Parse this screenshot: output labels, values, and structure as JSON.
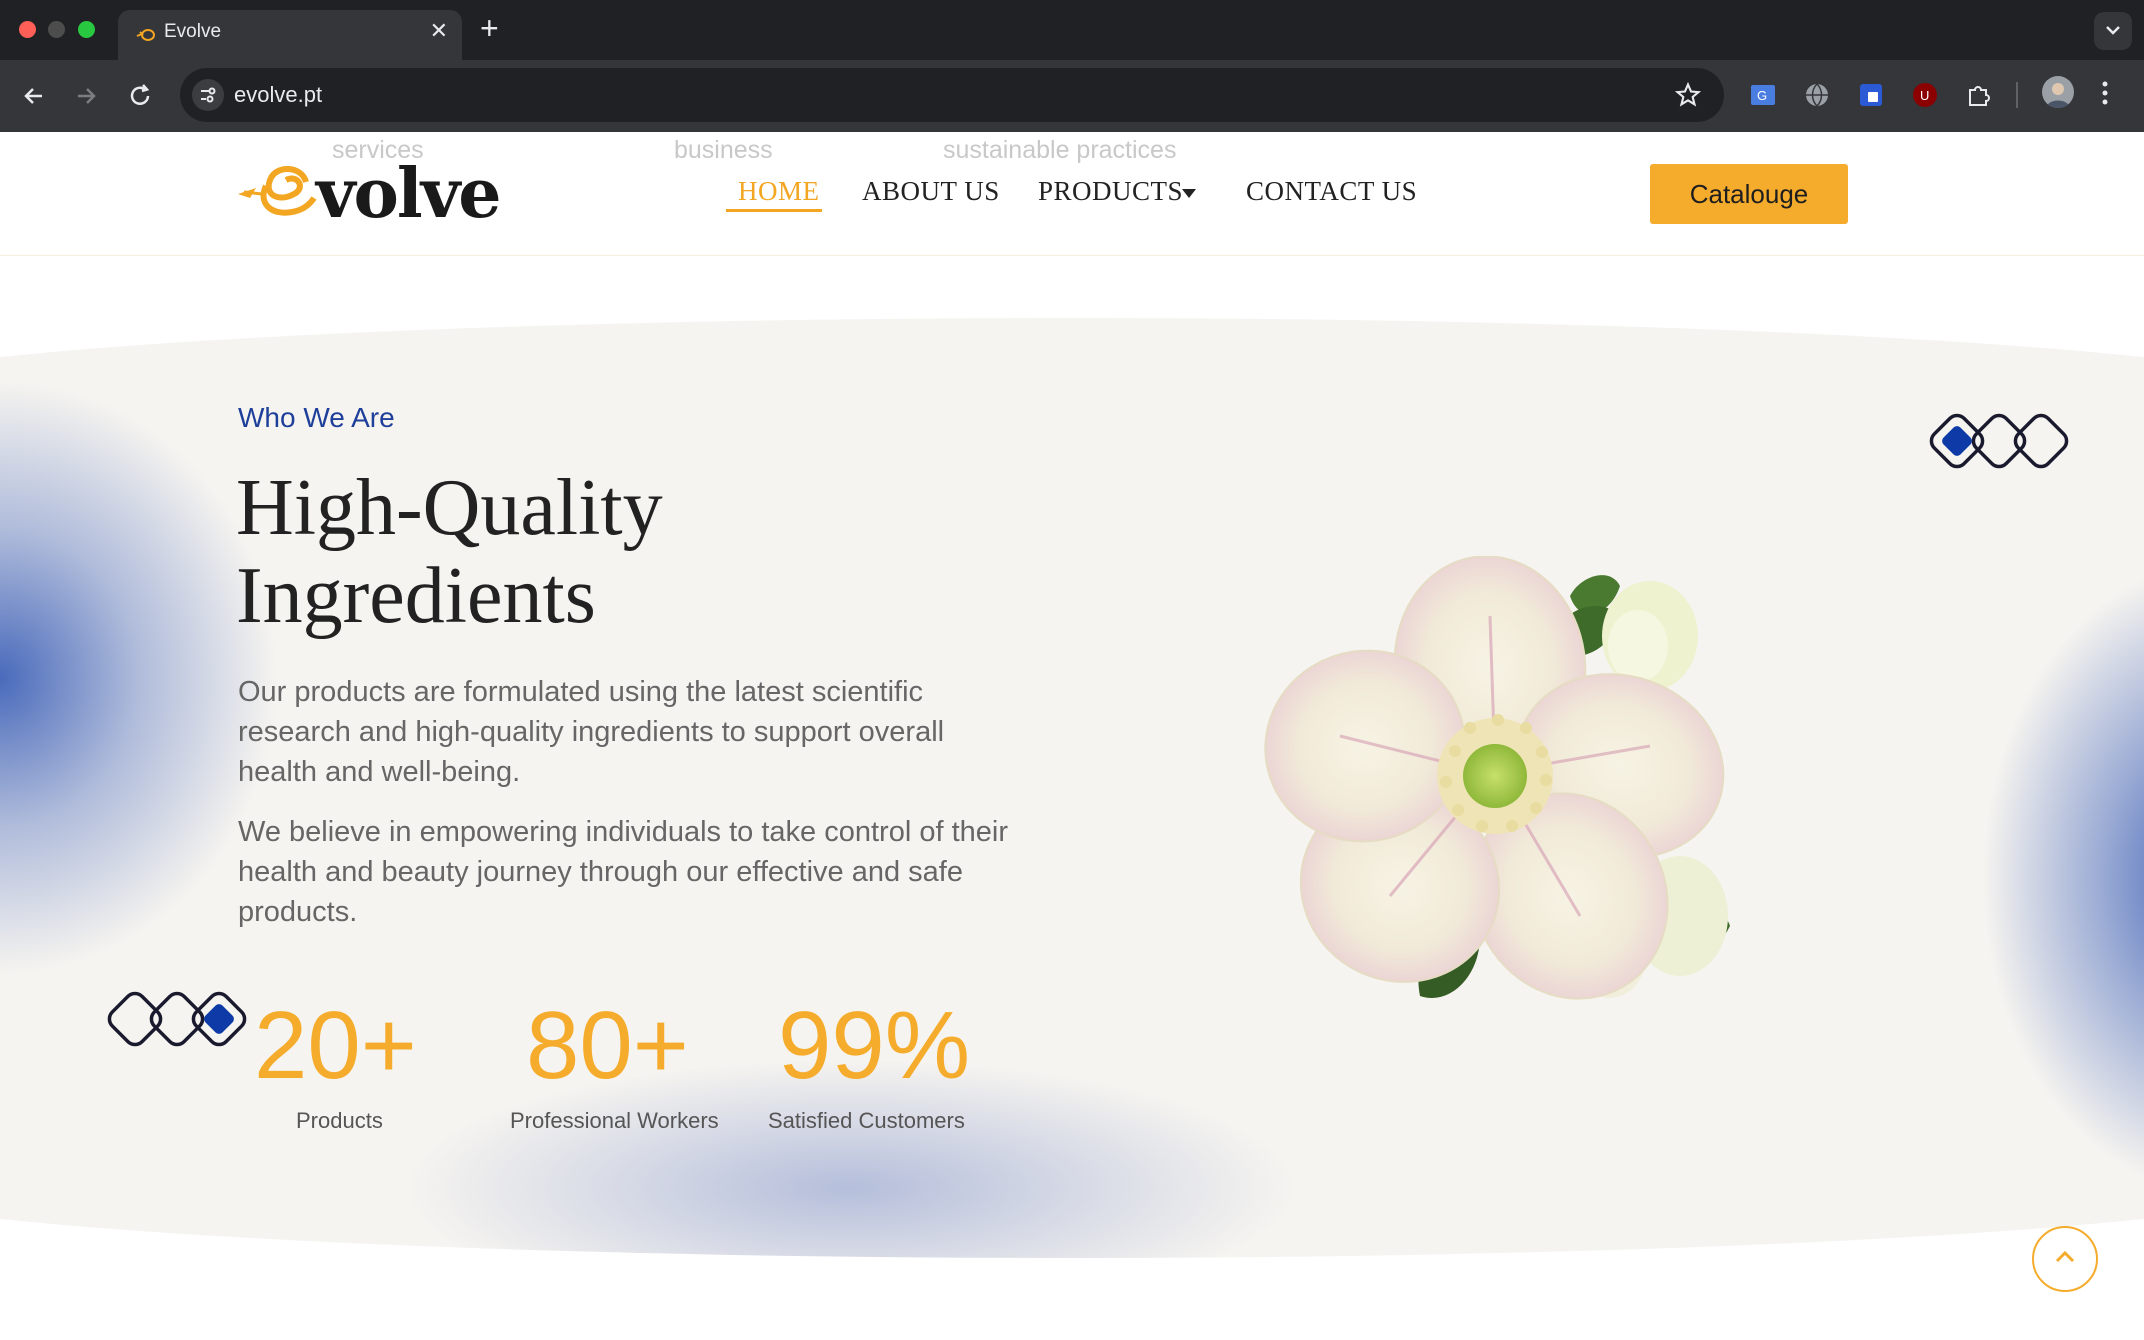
{
  "browser": {
    "tab_title": "Evolve",
    "url": "evolve.pt",
    "icons": [
      "close-icon",
      "plus-icon",
      "back-icon",
      "forward-icon",
      "reload-icon",
      "site-info-icon",
      "star-icon",
      "translate-icon",
      "globe-icon",
      "shield-icon",
      "ublock-icon",
      "puzzle-icon",
      "avatar",
      "more-vert-icon"
    ]
  },
  "header": {
    "ghost_words": [
      "services",
      "business",
      "sustainable practices"
    ],
    "logo_text": "volve",
    "nav": {
      "home": "HOME",
      "about": "ABOUT US",
      "products": "PRODUCTS",
      "contact": "CONTACT US"
    },
    "catalogue_button": "Catalouge"
  },
  "hero": {
    "eyebrow": "Who We Are",
    "headline_line1": "High-Quality",
    "headline_line2": "Ingredients",
    "paragraph1": "Our products are formulated using the latest scientific research and high-quality ingredients to support overall health and well-being.",
    "paragraph2": "We believe in empowering individuals to take control of their health and beauty journey through our effective and safe products.",
    "stats": [
      {
        "value": "20+",
        "label": "Products"
      },
      {
        "value": "80+",
        "label": "Professional Workers"
      },
      {
        "value": "99%",
        "label": "Satisfied Customers"
      }
    ]
  },
  "colors": {
    "accent": "#f5ac2c",
    "brand_blue": "#1e3f9a",
    "dark": "#222222"
  }
}
